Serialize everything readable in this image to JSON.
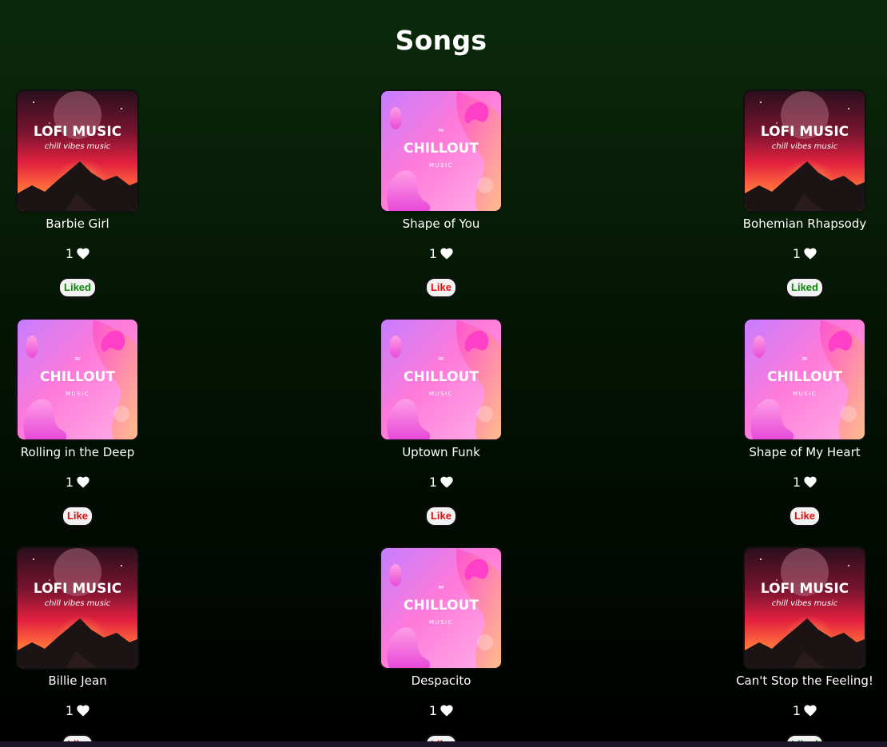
{
  "page": {
    "title": "Songs"
  },
  "cover_styles": {
    "lofi": {
      "line1": "LOFI MUSIC",
      "line2": "chill vibes music"
    },
    "chillout": {
      "line1": "CHILLOUT",
      "line2": "MUSIC",
      "mark": "≈"
    }
  },
  "songs": [
    {
      "title": "Barbie Girl",
      "likes": "1",
      "button": "Liked",
      "cover": "lofi"
    },
    {
      "title": "Shape of You",
      "likes": "1",
      "button": "Like",
      "cover": "chillout"
    },
    {
      "title": "Bohemian Rhapsody",
      "likes": "1",
      "button": "Liked",
      "cover": "lofi"
    },
    {
      "title": "Rolling in the Deep",
      "likes": "1",
      "button": "Like",
      "cover": "chillout"
    },
    {
      "title": "Uptown Funk",
      "likes": "1",
      "button": "Like",
      "cover": "chillout"
    },
    {
      "title": "Shape of My Heart",
      "likes": "1",
      "button": "Like",
      "cover": "chillout"
    },
    {
      "title": "Billie Jean",
      "likes": "1",
      "button": "Like",
      "cover": "lofi"
    },
    {
      "title": "Despacito",
      "likes": "1",
      "button": "Like",
      "cover": "chillout"
    },
    {
      "title": "Can't Stop the Feeling!",
      "likes": "1",
      "button": "Liked",
      "cover": "lofi"
    }
  ],
  "icons": {
    "like_count": "heart-icon"
  },
  "colors": {
    "liked": "#0a8a0a",
    "like": "#e01010"
  }
}
